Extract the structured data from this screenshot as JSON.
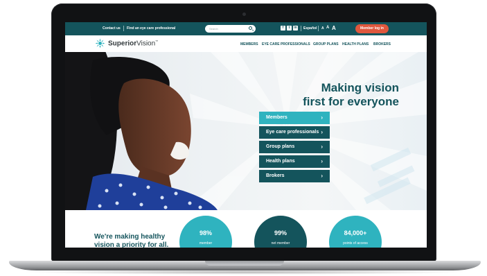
{
  "utility_bar": {
    "contact": "Contact us",
    "find_professional": "Find an eye care professional",
    "search_placeholder": "Search",
    "language": "Español",
    "text_size": [
      "A",
      "A",
      "A"
    ],
    "member_login": "Member log in",
    "social_icons": [
      "facebook-icon",
      "twitter-icon",
      "linkedin-icon"
    ]
  },
  "brand": {
    "name_bold": "Superior",
    "name_regular": "Vision",
    "mark": "™"
  },
  "nav": {
    "items": [
      "MEMBERS",
      "EYE CARE PROFESSIONALS",
      "GROUP PLANS",
      "HEALTH PLANS",
      "BROKERS"
    ]
  },
  "hero": {
    "title_line1": "Making vision",
    "title_line2": "first for everyone",
    "cta": [
      {
        "label": "Members",
        "color": "#2fb3bf"
      },
      {
        "label": "Eye care professionals",
        "color": "#14545c"
      },
      {
        "label": "Group plans",
        "color": "#14545c"
      },
      {
        "label": "Health plans",
        "color": "#14545c"
      },
      {
        "label": "Brokers",
        "color": "#14545c"
      }
    ],
    "chevron": "›"
  },
  "stats": {
    "heading_line1": "We're making healthy",
    "heading_line2": "vision a priority for all.",
    "items": [
      {
        "value": "98%",
        "caption": "member",
        "color": "#2fb3bf"
      },
      {
        "value": "99%",
        "caption": "net member",
        "color": "#14545c"
      },
      {
        "value": "84,000+",
        "caption": "points of access",
        "color": "#2fb3bf"
      }
    ]
  },
  "colors": {
    "brand_dark": "#14545c",
    "brand_light": "#2fb3bf",
    "accent": "#e0573d"
  }
}
